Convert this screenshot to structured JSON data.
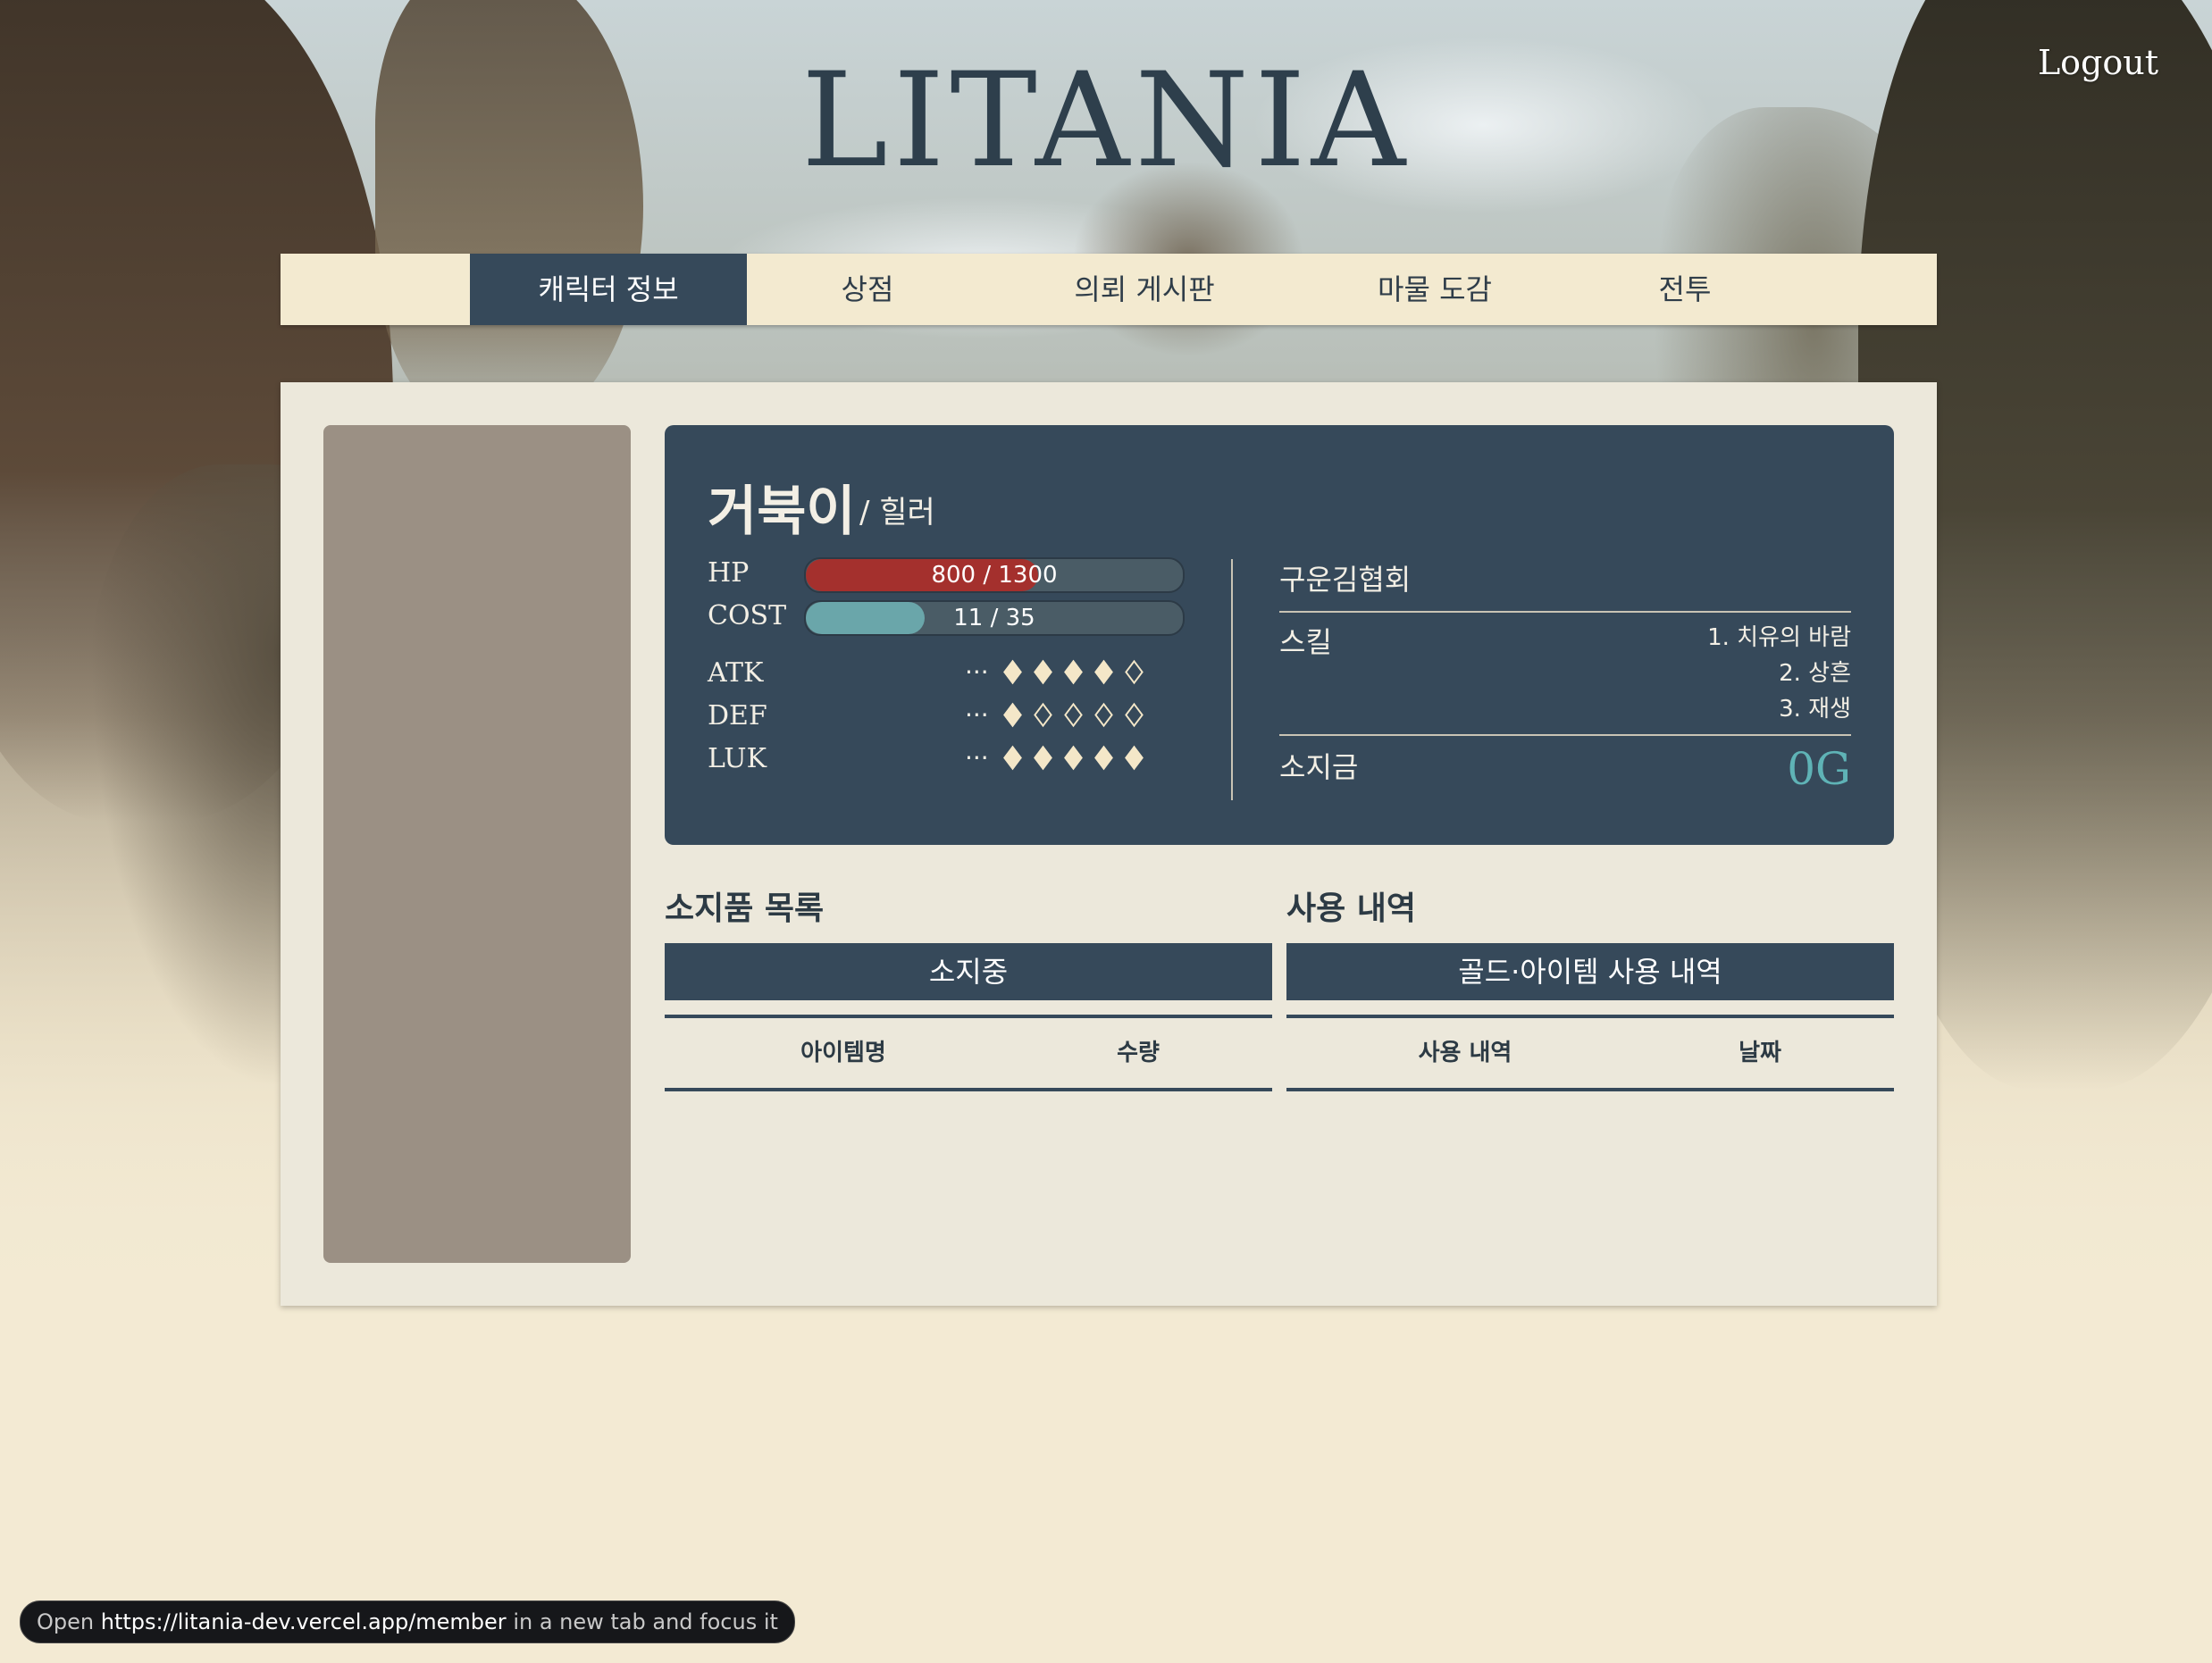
{
  "app": {
    "logo": "LITANIA",
    "logout_label": "Logout"
  },
  "nav": {
    "tabs": [
      {
        "label": "캐릭터 정보",
        "active": true
      },
      {
        "label": "상점",
        "active": false
      },
      {
        "label": "의뢰 게시판",
        "active": false
      },
      {
        "label": "마물 도감",
        "active": false
      },
      {
        "label": "전투",
        "active": false
      }
    ]
  },
  "character": {
    "name": "거북이",
    "class": "/ 힐러",
    "hp": {
      "label": "HP",
      "current": 800,
      "max": 1300,
      "text": "800 / 1300",
      "color": "#a4302d"
    },
    "cost": {
      "label": "COST",
      "current": 11,
      "max": 35,
      "text": "11 / 35",
      "color": "#6aa6aa"
    },
    "stats": [
      {
        "label": "ATK",
        "dots": "···",
        "level": 4,
        "max": 5
      },
      {
        "label": "DEF",
        "dots": "···",
        "level": 1,
        "max": 5
      },
      {
        "label": "LUK",
        "dots": "···",
        "level": 5,
        "max": 5
      }
    ],
    "guild": "구운김협회",
    "skill_label": "스킬",
    "skills": [
      "1. 치유의 바람",
      "2. 상흔",
      "3. 재생"
    ],
    "gold_label": "소지금",
    "gold_value": "0G"
  },
  "inventory": {
    "title": "소지품 목록",
    "header": "소지중",
    "columns": [
      "아이템명",
      "수량"
    ]
  },
  "history": {
    "title": "사용 내역",
    "header": "골드·아이템 사용 내역",
    "columns": [
      "사용 내역",
      "날짜"
    ]
  },
  "status_bar": {
    "prefix": "Open",
    "url": "https://litania-dev.vercel.app/member",
    "suffix": "in a new tab and focus it"
  },
  "colors": {
    "accent": "#36495a",
    "gold": "#5fb3b6",
    "pip": "#f4e7c8"
  }
}
